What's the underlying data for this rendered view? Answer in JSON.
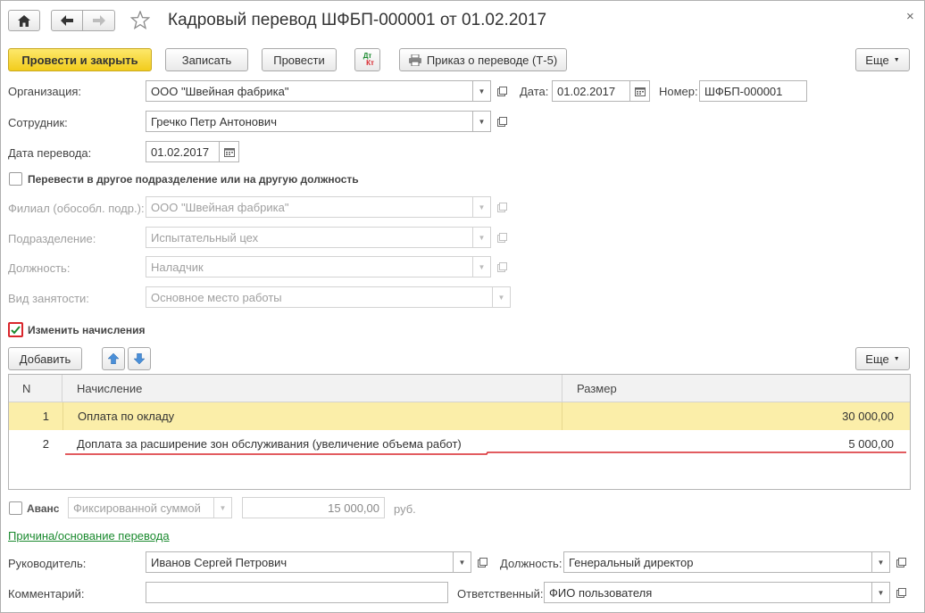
{
  "window": {
    "title": "Кадровый перевод ШФБП-000001 от 01.02.2017"
  },
  "toolbar": {
    "post_and_close": "Провести и закрыть",
    "save": "Записать",
    "post": "Провести",
    "dt_kt_top": "Дт",
    "dt_kt_bottom": "Кт",
    "print_order": "Приказ о переводе (Т-5)",
    "more": "Еще"
  },
  "header": {
    "org_label": "Организация:",
    "org_value": "ООО \"Швейная фабрика\"",
    "date_label": "Дата:",
    "date_value": "01.02.2017",
    "number_label": "Номер:",
    "number_value": "ШФБП-000001",
    "employee_label": "Сотрудник:",
    "employee_value": "Гречко Петр Антонович",
    "transfer_date_label": "Дата перевода:",
    "transfer_date_value": "01.02.2017"
  },
  "transfer": {
    "checkbox_label": "Перевести в другое подразделение или на другую должность",
    "checked": false,
    "branch_label": "Филиал (обособл. подр.):",
    "branch_value": "ООО \"Швейная фабрика\"",
    "department_label": "Подразделение:",
    "department_value": "Испытательный цех",
    "position_label": "Должность:",
    "position_value": "Наладчик",
    "employment_label": "Вид занятости:",
    "employment_value": "Основное место работы"
  },
  "accruals": {
    "checkbox_label": "Изменить начисления",
    "checked": true,
    "add_button": "Добавить",
    "more": "Еще",
    "columns": {
      "n": "N",
      "accrual": "Начисление",
      "amount": "Размер"
    },
    "rows": [
      {
        "n": "1",
        "accrual": "Оплата по окладу",
        "amount": "30 000,00"
      },
      {
        "n": "2",
        "accrual": "Доплата за расширение зон обслуживания (увеличение объема работ)",
        "amount": "5 000,00"
      }
    ]
  },
  "advance": {
    "label": "Аванс",
    "checked": false,
    "type_value": "Фиксированной суммой",
    "amount_value": "15 000,00",
    "currency": "руб."
  },
  "footer": {
    "reason_link": "Причина/основание перевода",
    "manager_label": "Руководитель:",
    "manager_value": "Иванов Сергей Петрович",
    "position_label": "Должность:",
    "position_value": "Генеральный директор",
    "comment_label": "Комментарий:",
    "comment_value": "",
    "responsible_label": "Ответственный:",
    "responsible_value": "ФИО пользователя"
  },
  "colors": {
    "primary_button": "#f2cc1c",
    "selected_row": "#fbeea9",
    "highlight_red": "#d9262c",
    "link_green": "#1b8a2f"
  }
}
